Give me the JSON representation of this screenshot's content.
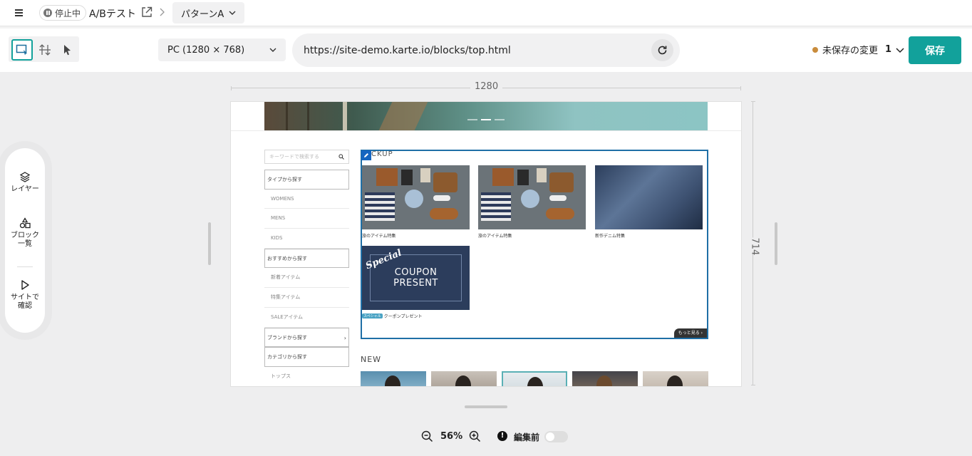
{
  "header": {
    "status": "停止中",
    "test_name": "A/Bテスト",
    "variant": "パターンA"
  },
  "toolbar": {
    "device": "PC (1280 × 768)",
    "url": "https://site-demo.karte.io/blocks/top.html",
    "unsaved_label": "未保存の変更",
    "unsaved_count": "1",
    "save_label": "保存"
  },
  "side_panel": {
    "layers": "レイヤー",
    "blocks_line1": "ブロック",
    "blocks_line2": "一覧",
    "preview_line1": "サイトで",
    "preview_line2": "確認"
  },
  "ruler": {
    "width": "1280",
    "height": "714"
  },
  "site": {
    "search_placeholder": "キーワードで検索する",
    "categories": [
      {
        "label": "タイプから探す",
        "type": "head"
      },
      {
        "label": "WOMENS",
        "type": "sub"
      },
      {
        "label": "MENS",
        "type": "sub"
      },
      {
        "label": "KIDS",
        "type": "sub"
      },
      {
        "label": "おすすめから探す",
        "type": "head"
      },
      {
        "label": "新着アイテム",
        "type": "sub"
      },
      {
        "label": "特集アイテム",
        "type": "sub"
      },
      {
        "label": "SALEアイテム",
        "type": "sub"
      },
      {
        "label": "ブランドから探す",
        "type": "head"
      },
      {
        "label": "カテゴリから探す",
        "type": "head"
      },
      {
        "label": "トップス",
        "type": "sub"
      }
    ],
    "pickup_title": "CKUP",
    "cards": {
      "c1": "旅のアイテム特集",
      "c2": "旅のアイテム特集",
      "c3": "新作デニム特集",
      "c4": "クーポンプレゼント"
    },
    "coupon_special": "Special",
    "coupon_line1": "COUPON",
    "coupon_line2": "PRESENT",
    "special_badge": "スペシャル",
    "more_label": "もっと見る ›",
    "new_title": "NEW"
  },
  "footer": {
    "zoom": "56%",
    "before_edit": "編集前"
  },
  "colors": {
    "accent": "#12a19b",
    "unsaved_dot": "#c98c3c",
    "selection": "#1f6fa6"
  }
}
